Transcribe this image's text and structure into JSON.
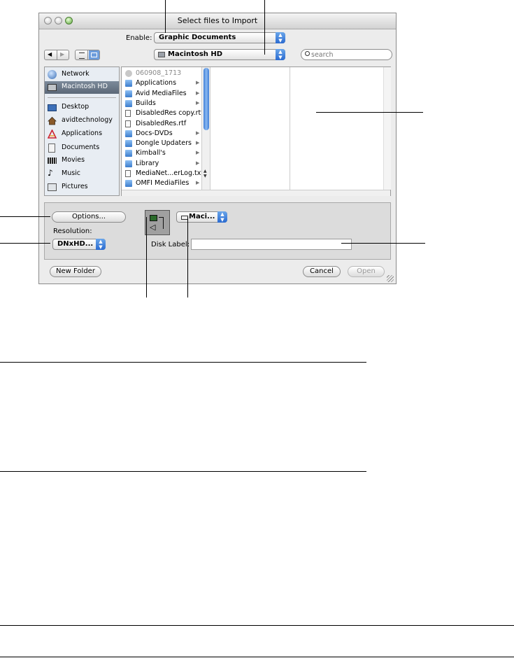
{
  "window": {
    "title": "Select files to Import"
  },
  "enable": {
    "label": "Enable:",
    "value": "Graphic Documents"
  },
  "location": {
    "value": "Macintosh HD"
  },
  "search": {
    "placeholder": "search"
  },
  "nav": {
    "back": "◀",
    "forward": "▶"
  },
  "sidebar": {
    "devices": [
      {
        "label": "Network",
        "icon": "globe-icon"
      },
      {
        "label": "Macintosh HD",
        "icon": "hard-drive-icon",
        "selected": true
      }
    ],
    "places": [
      {
        "label": "Desktop",
        "icon": "desktop-icon"
      },
      {
        "label": "avidtechnology",
        "icon": "home-icon"
      },
      {
        "label": "Applications",
        "icon": "applications-icon"
      },
      {
        "label": "Documents",
        "icon": "documents-icon"
      },
      {
        "label": "Movies",
        "icon": "movies-icon"
      },
      {
        "label": "Music",
        "icon": "music-icon"
      },
      {
        "label": "Pictures",
        "icon": "pictures-icon"
      }
    ]
  },
  "files": [
    {
      "name": "060908_1713",
      "icon": "disk-icon",
      "folder": false,
      "dim": true
    },
    {
      "name": "Applications",
      "icon": "folder-icon",
      "folder": true
    },
    {
      "name": "Avid MediaFiles",
      "icon": "folder-icon",
      "folder": true
    },
    {
      "name": "Builds",
      "icon": "folder-icon",
      "folder": true
    },
    {
      "name": "DisabledRes copy.rtf",
      "icon": "document-icon",
      "folder": false
    },
    {
      "name": "DisabledRes.rtf",
      "icon": "document-icon",
      "folder": false
    },
    {
      "name": "Docs-DVDs",
      "icon": "folder-icon",
      "folder": true
    },
    {
      "name": "Dongle Updaters",
      "icon": "folder-icon",
      "folder": true
    },
    {
      "name": "Kimball's",
      "icon": "folder-icon",
      "folder": true
    },
    {
      "name": "Library",
      "icon": "folder-icon",
      "folder": true
    },
    {
      "name": "MediaNet...erLog.txt",
      "icon": "document-icon",
      "folder": false
    },
    {
      "name": "OMFI MediaFiles",
      "icon": "folder-icon",
      "folder": true
    }
  ],
  "options": {
    "options_button": "Options...",
    "resolution_label": "Resolution:",
    "resolution_value": "DNxHD...",
    "drive_value": "Maci...",
    "disk_label_label": "Disk Label:",
    "disk_label_value": ""
  },
  "footer": {
    "new_folder": "New Folder",
    "cancel": "Cancel",
    "open": "Open"
  },
  "colors": {
    "accent": "#2a6ad0",
    "selection": "#5c6878",
    "window_bg": "#ececec"
  }
}
